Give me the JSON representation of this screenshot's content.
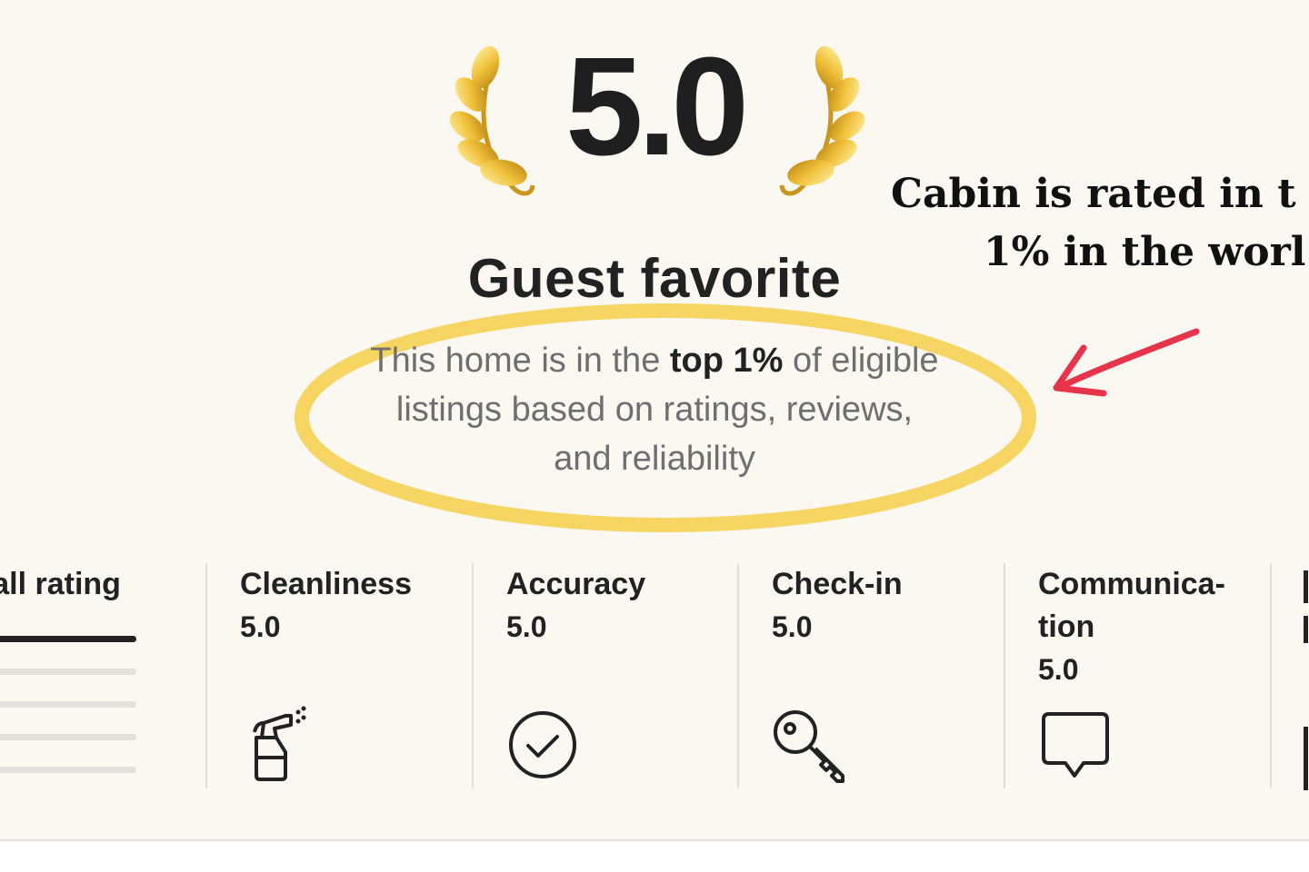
{
  "hero": {
    "score": "5.0",
    "title": "Guest favorite",
    "subtitle_pre": "This home is in the ",
    "subtitle_bold": "top 1%",
    "subtitle_post": " of eligible listings based on ratings, reviews, and reliability"
  },
  "annotation": {
    "line1": "Cabin is rated in t",
    "line2": "1% in the worl"
  },
  "overall": {
    "label": "rall rating",
    "bars": [
      1.0,
      0.0,
      0.0,
      0.0,
      0.0
    ]
  },
  "categories": [
    {
      "label": "Cleanliness",
      "value": "5.0",
      "icon": "spray-bottle-icon"
    },
    {
      "label": "Accuracy",
      "value": "5.0",
      "icon": "check-circle-icon"
    },
    {
      "label": "Check-in",
      "value": "5.0",
      "icon": "key-icon"
    },
    {
      "label": "Communica-",
      "label2": "tion",
      "value": "5.0",
      "icon": "speech-bubble-icon"
    }
  ],
  "colors": {
    "background": "#fbf7f1",
    "highlight": "#f5cf4a",
    "arrow": "#e8344a",
    "gold": "#e0a91c"
  }
}
